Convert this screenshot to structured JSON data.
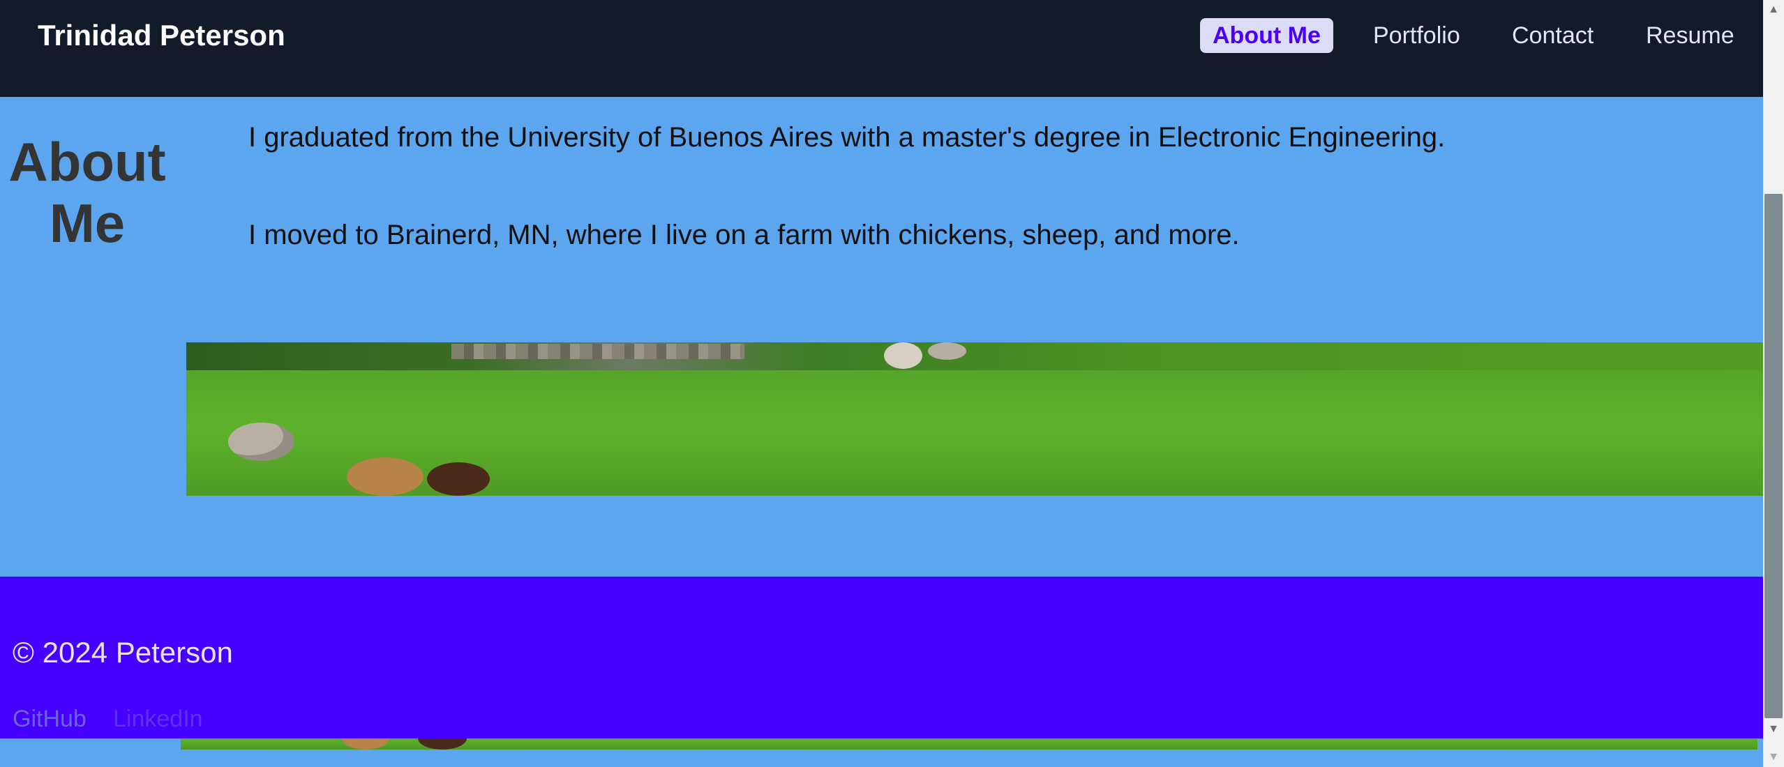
{
  "header": {
    "brand": "Trinidad Peterson",
    "nav": [
      {
        "label": "About Me",
        "active": true
      },
      {
        "label": "Portfolio",
        "active": false
      },
      {
        "label": "Contact",
        "active": false
      },
      {
        "label": "Resume",
        "active": false
      }
    ]
  },
  "main": {
    "title": "About Me",
    "paragraphs": [
      "I graduated from the University of Buenos Aires with a master's degree in Electronic Engineering.",
      "I moved to Brainerd, MN, where I live on a farm with chickens, sheep, and more."
    ],
    "photo_description": "farm field with sheep"
  },
  "footer": {
    "copyright": "© 2024 Peterson",
    "links": [
      "GitHub",
      "LinkedIn"
    ]
  },
  "colors": {
    "header_bg": "#131a2a",
    "page_bg": "#5ba6ef",
    "footer_bg": "#4600ff",
    "active_nav_text": "#4b00ff",
    "active_nav_bg": "#dcdcf7"
  },
  "icons": {
    "scroll_up": "chevron-up-icon",
    "scroll_down": "chevron-down-icon"
  }
}
